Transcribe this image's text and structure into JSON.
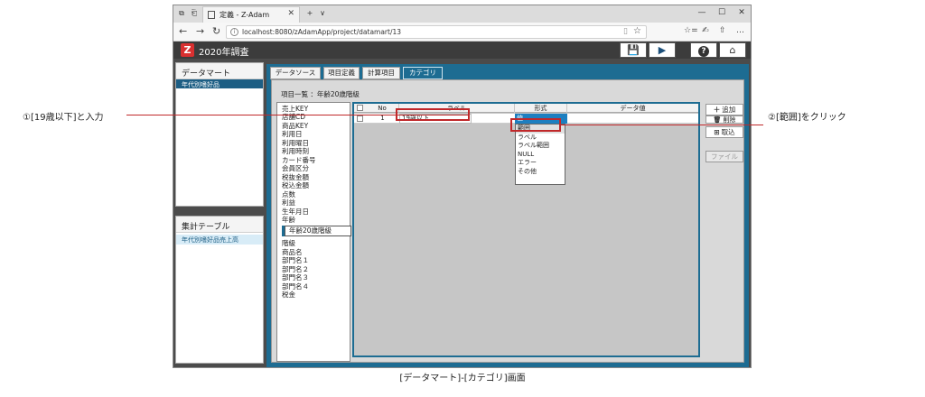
{
  "browser": {
    "tab_title": "定義 - Z-Adam",
    "tab_close": "✕",
    "new_tab": "+",
    "tab_menu": "∨",
    "url": "localhost:8080/zAdamApp/project/datamart/13",
    "window_controls": [
      "—",
      "☐",
      "✕"
    ],
    "nav": [
      "←",
      "→",
      "↻"
    ],
    "toolbar_icons": [
      "☆=",
      "✍",
      "⇧",
      "…"
    ]
  },
  "app": {
    "title": "2020年調査",
    "header_buttons": {
      "save": "💾",
      "run": "▶",
      "help": "?",
      "home": "⌂"
    }
  },
  "left_panels": {
    "datamart": {
      "header": "データマート",
      "selected": "年代別嗜好品"
    },
    "aggregate": {
      "header": "集計テーブル",
      "selected": "年代別嗜好品売上高"
    }
  },
  "tabs": [
    {
      "label": "データソース",
      "active": false
    },
    {
      "label": "項目定義",
      "active": false
    },
    {
      "label": "計算項目",
      "active": false
    },
    {
      "label": "カテゴリ",
      "active": true
    }
  ],
  "subtitle": "項目一覧 ：年齢20歳階級",
  "fields": [
    "売上KEY",
    "店舗CD",
    "商品KEY",
    "利用日",
    "利用曜日",
    "利用時刻",
    "カード番号",
    "会員区分",
    "税抜金額",
    "税込金額",
    "点数",
    "利益",
    "生年月日",
    "年齢"
  ],
  "highlighted_field": "年齢20歳階級",
  "fields_after": [
    "階級",
    "商品名",
    "部門名１",
    "部門名２",
    "部門名３",
    "部門名４",
    "税金"
  ],
  "table": {
    "headers": [
      "No",
      "ラベル",
      "形式",
      "データ値"
    ],
    "row": {
      "no": "1",
      "label": "19歳以下",
      "type": "値"
    },
    "type_options": [
      "範囲",
      "ラベル",
      "ラベル範囲",
      "NULL",
      "エラー",
      "その他"
    ]
  },
  "right_buttons": {
    "add": "追加",
    "delete": "削除",
    "import": "取込",
    "file": "ファイル"
  },
  "annotations": {
    "left": "①[19歳以下]と入力",
    "right": "②[範囲]をクリック",
    "caption": "[データマート]-[カテゴリ]画面"
  }
}
